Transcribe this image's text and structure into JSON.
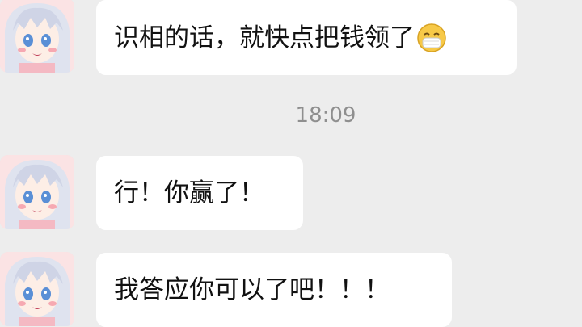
{
  "chat": {
    "messages": [
      {
        "text": "识相的话，就快点把钱领了",
        "emoji": "mask-face-emoji"
      },
      {
        "text": "行！你赢了！"
      },
      {
        "text": "我答应你可以了吧！！！"
      }
    ],
    "timestamp": "18:09"
  },
  "colors": {
    "background": "#ededed",
    "bubble": "#ffffff",
    "text": "#111111",
    "timestamp": "#8f8f8f"
  },
  "icons": {
    "avatar": "anime-girl-avatar",
    "emoji": "mask-face-emoji"
  }
}
